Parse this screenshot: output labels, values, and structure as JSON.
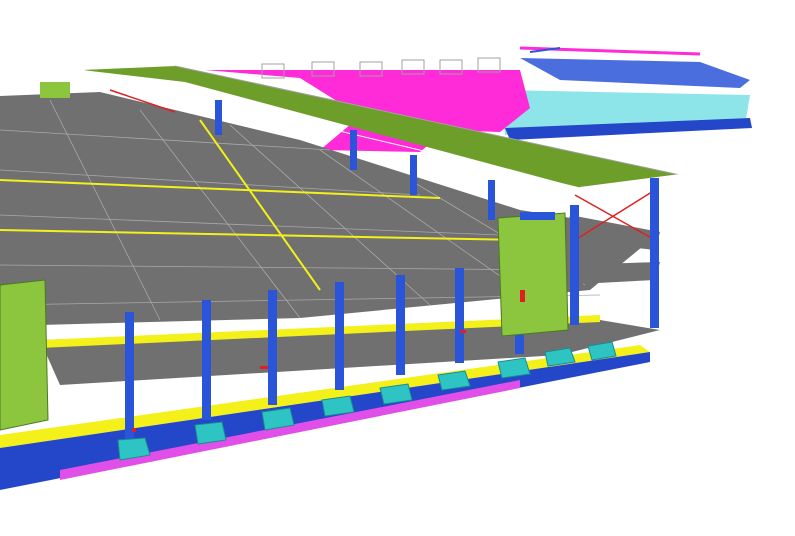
{
  "viewport": {
    "model_type": "3d-structural-building-model",
    "background": "#ffffff"
  },
  "colors": {
    "floor_slab": "#707070",
    "slab_grid": "#a8a8a8",
    "column": "#2a55d8",
    "edge_beam": "#f3f01a",
    "core_wall": "#8cc63e",
    "roof_deck": "#6e9e2a",
    "foundation_pad": "#2ec4c4",
    "ground_beam": "#e050e8",
    "base_wall": "#2446c8",
    "bracing": "#e02020",
    "service_zone": "#ff2ad8",
    "secondary_structure": "#30d0d8"
  },
  "model": {
    "levels": 3,
    "column_count": 13,
    "core_count": 2,
    "pile_cap_count": 9
  }
}
